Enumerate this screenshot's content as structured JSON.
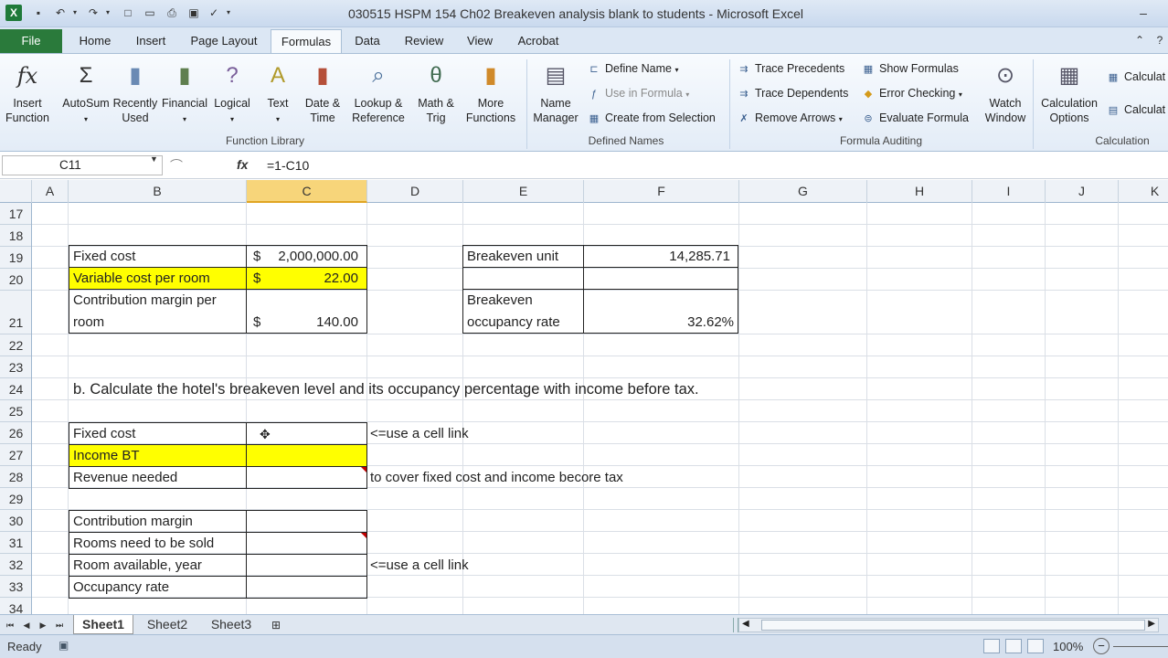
{
  "app": {
    "title": "030515 HSPM 154 Ch02 Breakeven analysis blank to students - Microsoft Excel",
    "logo_letter": "X"
  },
  "quick_access": [
    "save-icon",
    "undo-icon",
    "redo-icon",
    "new-icon",
    "open-icon",
    "print-icon",
    "spelling-icon"
  ],
  "tabs": [
    "File",
    "Home",
    "Insert",
    "Page Layout",
    "Formulas",
    "Data",
    "Review",
    "View",
    "Acrobat"
  ],
  "active_tab": "Formulas",
  "ribbon": {
    "function_library": {
      "label": "Function Library",
      "insert_function": [
        "Insert",
        "Function"
      ],
      "autosum": "AutoSum",
      "recently_used": [
        "Recently",
        "Used"
      ],
      "financial": "Financial",
      "logical": "Logical",
      "text": "Text",
      "date_time": [
        "Date &",
        "Time"
      ],
      "lookup": [
        "Lookup &",
        "Reference"
      ],
      "math": [
        "Math &",
        "Trig"
      ],
      "more": [
        "More",
        "Functions"
      ]
    },
    "defined_names": {
      "label": "Defined Names",
      "name_manager": [
        "Name",
        "Manager"
      ],
      "define_name": "Define Name",
      "use_in_formula": "Use in Formula",
      "create_from_selection": "Create from Selection"
    },
    "formula_auditing": {
      "label": "Formula Auditing",
      "trace_precedents": "Trace Precedents",
      "trace_dependents": "Trace Dependents",
      "remove_arrows": "Remove Arrows",
      "show_formulas": "Show Formulas",
      "error_checking": "Error Checking",
      "evaluate_formula": "Evaluate Formula",
      "watch_window": [
        "Watch",
        "Window"
      ]
    },
    "calculation": {
      "label": "Calculation",
      "calculation_options": [
        "Calculation",
        "Options"
      ],
      "calc_now": "Calculat",
      "calc_sheet": "Calculat"
    }
  },
  "formula_bar": {
    "name_box": "C11",
    "formula": "=1-C10",
    "fx": "fx"
  },
  "columns": [
    "A",
    "B",
    "C",
    "D",
    "E",
    "F",
    "G",
    "H",
    "I",
    "J",
    "K"
  ],
  "selected_column": "C",
  "rows": [
    "17",
    "18",
    "19",
    "20",
    "21",
    "22",
    "23",
    "24",
    "25",
    "26",
    "27",
    "28",
    "29",
    "30",
    "31",
    "32",
    "33",
    "34"
  ],
  "cells": {
    "b19": "Fixed cost",
    "c19_sym": "$",
    "c19": "2,000,000.00",
    "b20": "Variable cost per room",
    "c20_sym": "$",
    "c20": "22.00",
    "b21_l1": "Contribution margin per",
    "b21_l2": "room",
    "c21_sym": "$",
    "c21": "140.00",
    "e19": "Breakeven unit",
    "f19": "14,285.71",
    "e21_l1": "Breakeven",
    "e21_l2": "occupancy rate",
    "f21": "32.62%",
    "b24": "b.  Calculate the hotel's breakeven level and its occupancy percentage with income before tax.",
    "b26": "Fixed cost",
    "d26": "<=use a cell link",
    "b27": "Income BT",
    "b28": "Revenue needed",
    "d28": "to cover fixed cost and income becore tax",
    "b30": "Contribution margin",
    "b31": "Rooms need to be sold",
    "b32": "Room available, year",
    "d32": "<=use a cell link",
    "b33": "Occupancy rate"
  },
  "sheets": [
    "Sheet1",
    "Sheet2",
    "Sheet3"
  ],
  "active_sheet": "Sheet1",
  "status": {
    "ready": "Ready",
    "zoom": "100%"
  },
  "colors": {
    "highlight_yellow": "#ffff00",
    "file_tab": "#2a7a3b",
    "selected_header": "#f7d57a"
  }
}
